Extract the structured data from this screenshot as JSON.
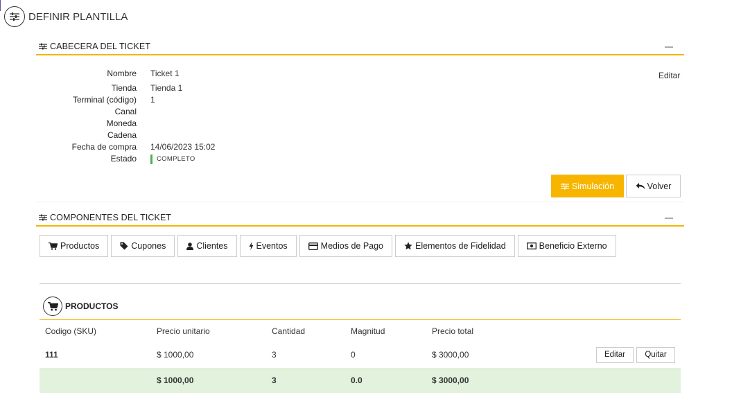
{
  "page": {
    "title": "DEFINIR PLANTILLA",
    "icon": "sliders-icon"
  },
  "header_section": {
    "title": "CABECERA DEL TICKET",
    "edit_label": "Editar",
    "fields": [
      {
        "label": "Nombre",
        "value": "Ticket 1"
      },
      {
        "label": "Tienda",
        "value": "Tienda 1"
      },
      {
        "label": "Terminal (código)",
        "value": "1"
      },
      {
        "label": "Canal",
        "value": ""
      },
      {
        "label": "Moneda",
        "value": ""
      },
      {
        "label": "Cadena",
        "value": ""
      },
      {
        "label": "Fecha de compra",
        "value": "14/06/2023 15:02"
      }
    ],
    "status_label": "Estado",
    "status_value": "COMPLETO",
    "status_color": "#4caf50",
    "simulate_label": "Simulación",
    "back_label": "Volver"
  },
  "components_section": {
    "title": "COMPONENTES DEL TICKET",
    "tabs": [
      {
        "label": "Productos",
        "icon": "cart-icon"
      },
      {
        "label": "Cupones",
        "icon": "tag-icon"
      },
      {
        "label": "Clientes",
        "icon": "user-icon"
      },
      {
        "label": "Eventos",
        "icon": "bolt-icon"
      },
      {
        "label": "Medios de Pago",
        "icon": "credit-card-icon"
      },
      {
        "label": "Elementos de Fidelidad",
        "icon": "star-icon"
      },
      {
        "label": "Beneficio Externo",
        "icon": "money-icon"
      }
    ]
  },
  "products": {
    "title": "PRODUCTOS",
    "columns": [
      "Codigo (SKU)",
      "Precio unitario",
      "Cantidad",
      "Magnitud",
      "Precio total"
    ],
    "rows": [
      {
        "sku": "111",
        "unit_price": "$ 1000,00",
        "quantity": "3",
        "magnitude": "0",
        "total": "$ 3000,00"
      }
    ],
    "row_edit_label": "Editar",
    "row_remove_label": "Quitar",
    "totals": {
      "unit_price": "$ 1000,00",
      "quantity": "3",
      "magnitude": "0.0",
      "total": "$ 3000,00"
    }
  },
  "colors": {
    "accent": "#f5b400",
    "button": "#f7b500",
    "totals_bg": "#e2f2dc"
  }
}
